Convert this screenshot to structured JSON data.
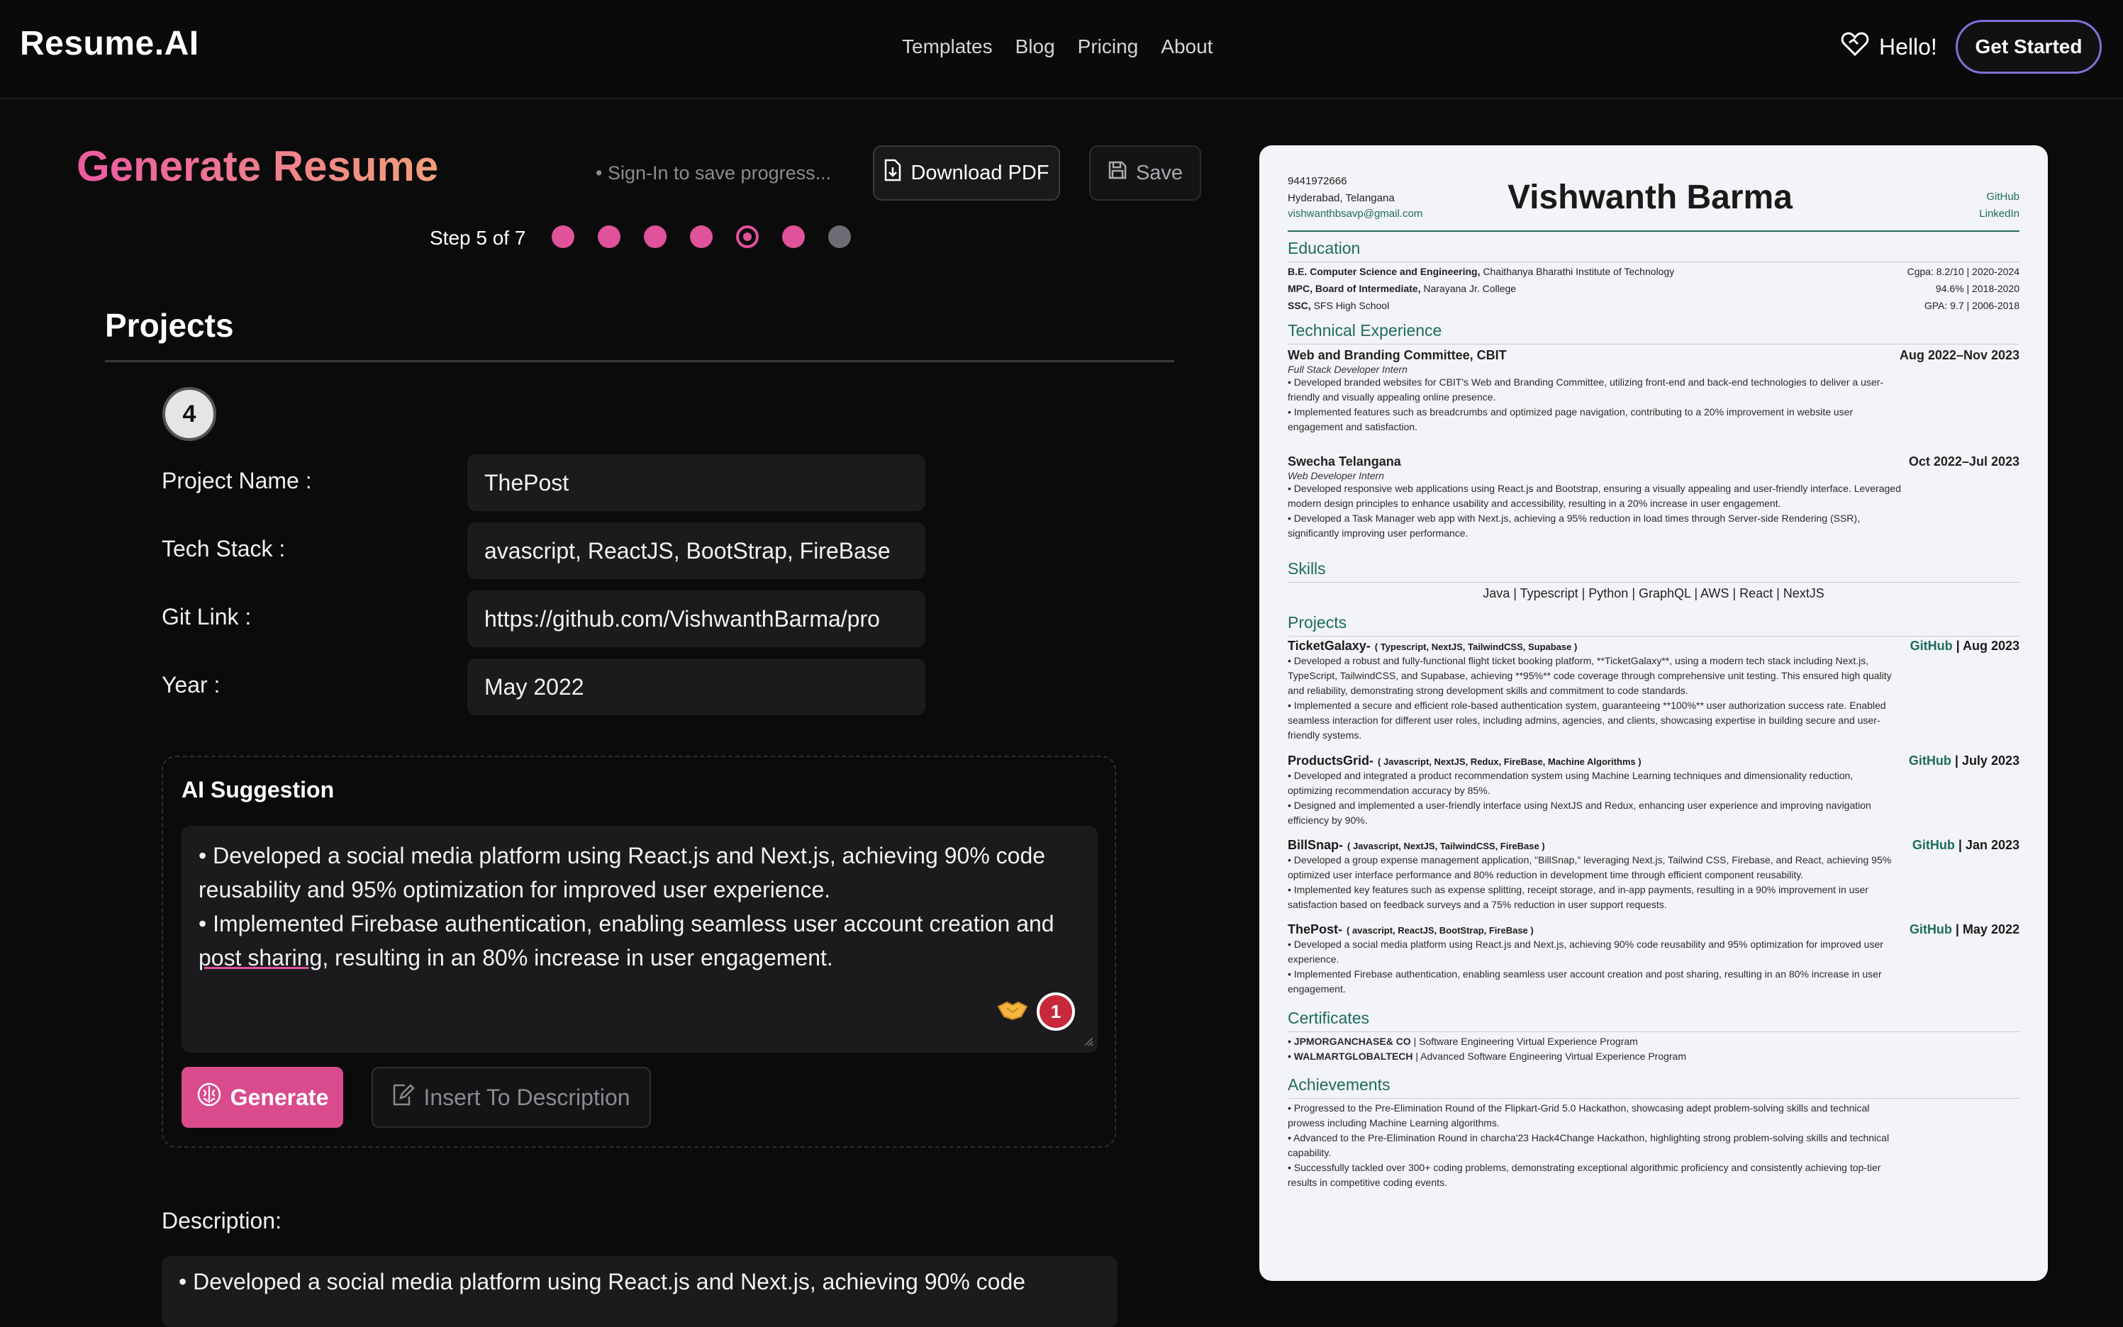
{
  "nav": {
    "logo": "Resume.AI",
    "links": [
      "Templates",
      "Blog",
      "Pricing",
      "About"
    ],
    "hello": "Hello!",
    "cta": "Get Started"
  },
  "editor": {
    "title": "Generate Resume",
    "signin_hint": "• Sign-In to save progress...",
    "download_label": "Download PDF",
    "save_label": "Save",
    "step_text": "Step 5 of 7",
    "step_current": 5,
    "step_total": 7,
    "section_title": "Projects",
    "project_number": "4",
    "fields": {
      "name_label": "Project Name :",
      "name_value": "ThePost",
      "stack_label": "Tech Stack :",
      "stack_value": "avascript, ReactJS, BootStrap, FireBase",
      "git_label": "Git Link :",
      "git_value": "https://github.com/VishwanthBarma/pro",
      "year_label": "Year :",
      "year_value": "May 2022"
    },
    "ai": {
      "title": "AI Suggestion",
      "line1": "• Developed a social media platform using React.js and Next.js, achieving 90% code reusability and 95% optimization for improved user experience.",
      "line2_pre": "•  Implemented Firebase authentication, enabling seamless user account creation and ",
      "line2_err": "post sharing",
      "line2_post": ", resulting in an 80% increase in user engagement.",
      "notif_count": "1",
      "generate_label": "Generate",
      "insert_label": "Insert To Description"
    },
    "description_label": "Description:",
    "description_value": "• Developed a social media platform using React.js and Next.js, achieving 90% code"
  },
  "resume": {
    "phone": "9441972666",
    "location": "Hyderabad, Telangana",
    "email": "vishwanthbsavp@gmail.com",
    "name": "Vishwanth Barma",
    "links": [
      "GitHub",
      "LinkedIn"
    ],
    "h_education": "Education",
    "education": [
      {
        "degree": "B.E. Computer Science and Engineering,",
        "school": " Chaithanya Bharathi Institute of Technology",
        "right": "Cgpa: 8.2/10 | 2020-2024"
      },
      {
        "degree": "MPC, Board of Intermediate,",
        "school": " Narayana Jr. College",
        "right": "94.6% | 2018-2020"
      },
      {
        "degree": "SSC,",
        "school": " SFS High School",
        "right": "GPA: 9.7 | 2006-2018"
      }
    ],
    "h_experience": "Technical Experience",
    "experience": [
      {
        "org": "Web and Branding Committee, CBIT",
        "date": "Aug 2022–Nov 2023",
        "role": "Full Stack Developer Intern",
        "b1a": "• Developed branded websites for CBIT's Web and Branding Committee, utilizing front-end and back-end technologies to deliver a user-",
        "b1b": "friendly and visually appealing online presence.",
        "b2a": "• Implemented features such as breadcrumbs and optimized page navigation, contributing to a 20% improvement in website user",
        "b2b": "engagement and satisfaction."
      },
      {
        "org": "Swecha Telangana",
        "date": "Oct 2022–Jul 2023",
        "role": "Web Developer Intern",
        "b1a": "• Developed responsive web applications using React.js and Bootstrap, ensuring a visually appealing and user-friendly interface. Leveraged",
        "b1b": "modern design principles to enhance usability and accessibility, resulting in a 20% increase in user engagement.",
        "b2a": "• Developed a Task Manager web app with Next.js, achieving a 95% reduction in load times through Server-side Rendering (SSR),",
        "b2b": "significantly improving user performance."
      }
    ],
    "h_skills": "Skills",
    "skills": "Java  |  Typescript  |  Python  |  GraphQL  |  AWS  |  React  |  NextJS",
    "h_projects": "Projects",
    "projects": [
      {
        "name": "TicketGalaxy-",
        "stack": "( Typescript, NextJS, TailwindCSS, Supabase )",
        "gh": "GitHub",
        "date": " | Aug 2023",
        "lines": [
          "• Developed a robust and fully-functional flight ticket booking platform, **TicketGalaxy**, using a modern tech stack including Next.js,",
          "TypeScript, TailwindCSS, and Supabase, achieving **95%** code coverage through comprehensive unit testing. This ensured high quality",
          "and reliability, demonstrating strong development skills and commitment to code standards.",
          "• Implemented a secure and efficient role-based authentication system, guaranteeing **100%** user authorization success rate. Enabled",
          "seamless interaction for different user roles, including admins, agencies, and clients, showcasing expertise in building secure and user-",
          "friendly systems."
        ]
      },
      {
        "name": "ProductsGrid-",
        "stack": "( Javascript, NextJS, Redux, FireBase, Machine Algorithms )",
        "gh": "GitHub",
        "date": " | July 2023",
        "lines": [
          "• Developed and integrated a product recommendation system using Machine Learning techniques and dimensionality reduction,",
          "optimizing recommendation accuracy by 85%.",
          "• Designed and implemented a user-friendly interface using NextJS and Redux, enhancing user experience and improving navigation",
          "efficiency by 90%."
        ]
      },
      {
        "name": "BillSnap-",
        "stack": "( Javascript, NextJS, TailwindCSS, FireBase )",
        "gh": "GitHub",
        "date": " | Jan 2023",
        "lines": [
          "• Developed a group expense management application, \"BillSnap,\" leveraging Next.js, Tailwind CSS, Firebase, and React, achieving 95%",
          "optimized user interface performance and 80% reduction in development time through efficient component reusability.",
          "• Implemented key features such as expense splitting, receipt storage, and in-app payments, resulting in a 90% improvement in user",
          "satisfaction based on feedback surveys and a 75% reduction in user support requests."
        ]
      },
      {
        "name": "ThePost-",
        "stack": "( avascript, ReactJS, BootStrap, FireBase )",
        "gh": "GitHub",
        "date": " | May 2022",
        "lines": [
          "• Developed a social media platform using React.js and Next.js, achieving 90% code reusability and 95% optimization for improved user",
          "experience.",
          "• Implemented Firebase authentication, enabling seamless user account creation and post sharing, resulting in an 80% increase in user",
          "engagement."
        ]
      }
    ],
    "h_certificates": "Certificates",
    "certificates": [
      {
        "org": "• JPMORGANCHASE& CO",
        "text": " | Software Engineering Virtual Experience Program"
      },
      {
        "org": "• WALMARTGLOBALTECH",
        "text": " | Advanced Software Engineering Virtual Experience Program"
      }
    ],
    "h_achievements": "Achievements",
    "achievements": [
      "• Progressed to the Pre-Elimination Round of the Flipkart-Grid 5.0 Hackathon, showcasing adept problem-solving skills and technical",
      "prowess including Machine Learning algorithms.",
      "• Advanced to the Pre-Elimination Round in charcha'23 Hack4Change Hackathon, highlighting strong problem-solving skills and technical",
      "capability.",
      "• Successfully tackled over 300+ coding problems, demonstrating exceptional algorithmic proficiency and consistently achieving top-tier",
      "results in competitive coding events."
    ]
  }
}
